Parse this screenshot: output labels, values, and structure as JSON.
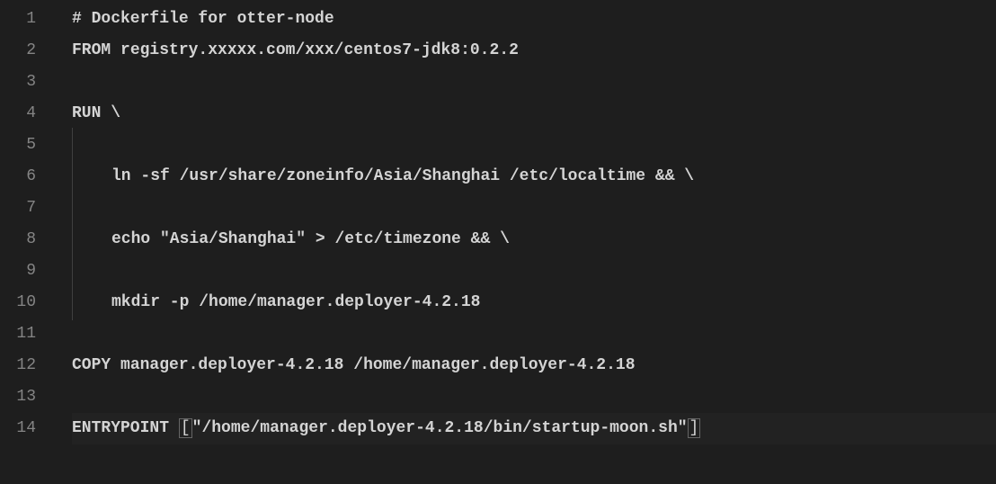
{
  "editor": {
    "lines": [
      {
        "num": "1",
        "segments": [
          {
            "t": "# Dockerfile for otter-node",
            "c": "comment bold"
          }
        ],
        "indent": false
      },
      {
        "num": "2",
        "segments": [
          {
            "t": "FROM",
            "c": "instr"
          },
          {
            "t": " registry.xxxxx.com/xxx/centos7-jdk8:0.2.2",
            "c": "plain bold"
          }
        ],
        "indent": false
      },
      {
        "num": "3",
        "segments": [],
        "indent": false
      },
      {
        "num": "4",
        "segments": [
          {
            "t": "RUN",
            "c": "instr"
          },
          {
            "t": " \\",
            "c": "plain bold"
          }
        ],
        "indent": false
      },
      {
        "num": "5",
        "segments": [],
        "indent": true
      },
      {
        "num": "6",
        "segments": [
          {
            "t": "ln -sf /usr/share/zoneinfo/Asia/Shanghai /etc/localtime && \\",
            "c": "plain bold"
          }
        ],
        "indent": true
      },
      {
        "num": "7",
        "segments": [],
        "indent": true
      },
      {
        "num": "8",
        "segments": [
          {
            "t": "echo \"Asia/Shanghai\" > /etc/timezone && \\",
            "c": "plain bold"
          }
        ],
        "indent": true
      },
      {
        "num": "9",
        "segments": [],
        "indent": true
      },
      {
        "num": "10",
        "segments": [
          {
            "t": "mkdir -p /home/manager.deployer-4.2.18",
            "c": "plain bold"
          }
        ],
        "indent": true
      },
      {
        "num": "11",
        "segments": [],
        "indent": false
      },
      {
        "num": "12",
        "segments": [
          {
            "t": "COPY",
            "c": "instr"
          },
          {
            "t": " manager.deployer-4.2.18 /home/manager.deployer-4.2.18",
            "c": "plain bold"
          }
        ],
        "indent": false
      },
      {
        "num": "13",
        "segments": [],
        "indent": false
      },
      {
        "num": "14",
        "segments": [
          {
            "t": "ENTRYPOINT",
            "c": "instr"
          },
          {
            "t": " ",
            "c": "plain"
          },
          {
            "t": "[",
            "c": "plain bracket-box"
          },
          {
            "t": "\"/home/manager.deployer-4.2.18/bin/startup-moon.sh\"",
            "c": "plain bold"
          },
          {
            "t": "]",
            "c": "plain bracket-box"
          }
        ],
        "indent": false,
        "highlight": true
      }
    ]
  }
}
